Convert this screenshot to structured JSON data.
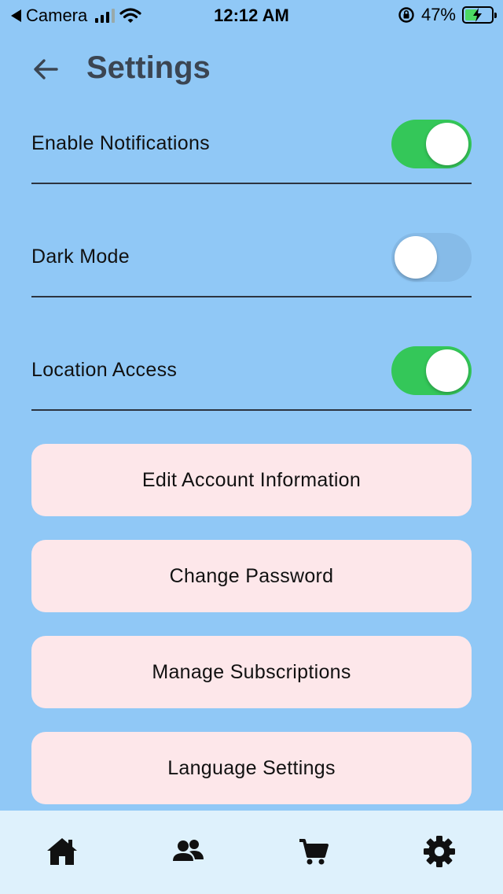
{
  "status_bar": {
    "back_app": "Camera",
    "time": "12:12 AM",
    "battery": "47%"
  },
  "header": {
    "title": "Settings",
    "back_icon": "arrow-left-icon"
  },
  "settings": [
    {
      "label": "Enable Notifications",
      "enabled": true
    },
    {
      "label": "Dark Mode",
      "enabled": false
    },
    {
      "label": "Location Access",
      "enabled": true
    }
  ],
  "actions": [
    {
      "label": "Edit Account Information"
    },
    {
      "label": "Change Password"
    },
    {
      "label": "Manage Subscriptions"
    },
    {
      "label": "Language Settings"
    }
  ],
  "bottom_nav": [
    {
      "icon": "home-icon"
    },
    {
      "icon": "users-icon"
    },
    {
      "icon": "cart-icon"
    },
    {
      "icon": "gear-icon"
    }
  ],
  "colors": {
    "background": "#90c8f6",
    "toggle_on": "#34c759",
    "button_bg": "#fde7ea",
    "nav_bg": "#def1fc"
  }
}
